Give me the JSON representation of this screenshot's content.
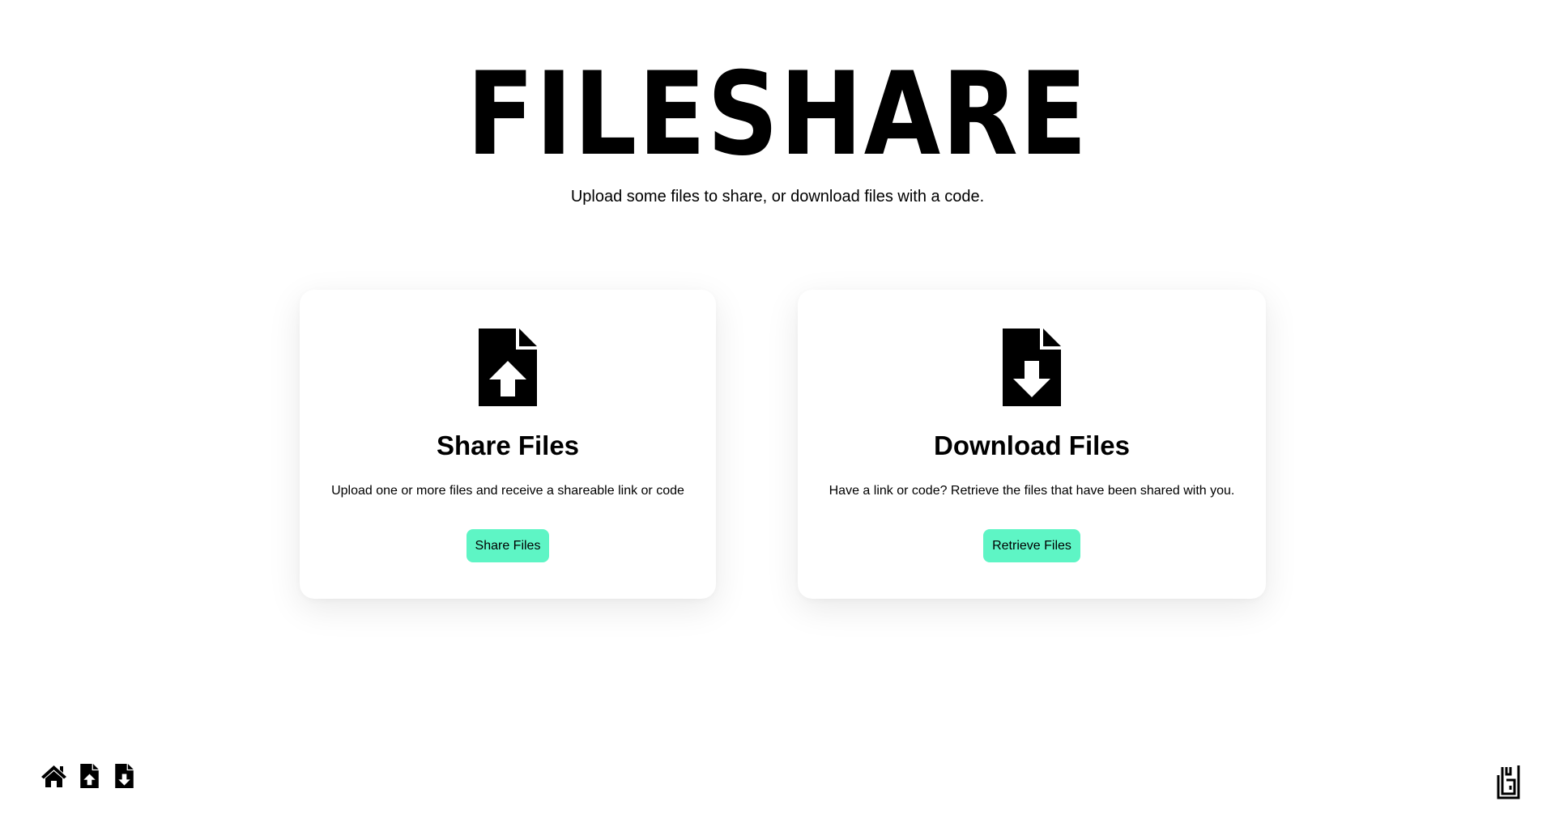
{
  "hero": {
    "title": "FILESHARE",
    "subtitle": "Upload some files to share, or download files with a code."
  },
  "cards": {
    "share": {
      "icon": "file-upload-icon",
      "title": "Share Files",
      "description": "Upload one or more files and receive a shareable link or code",
      "button_label": "Share Files"
    },
    "download": {
      "icon": "file-download-icon",
      "title": "Download Files",
      "description": "Have a link or code? Retrieve the files that have been shared with you.",
      "button_label": "Retrieve Files"
    }
  },
  "footer": {
    "nav_icons": [
      "home-icon",
      "file-upload-icon",
      "file-download-icon"
    ],
    "logo": "brand-logo"
  },
  "colors": {
    "accent": "#5ef5c5",
    "text": "#000000",
    "background": "#ffffff"
  }
}
